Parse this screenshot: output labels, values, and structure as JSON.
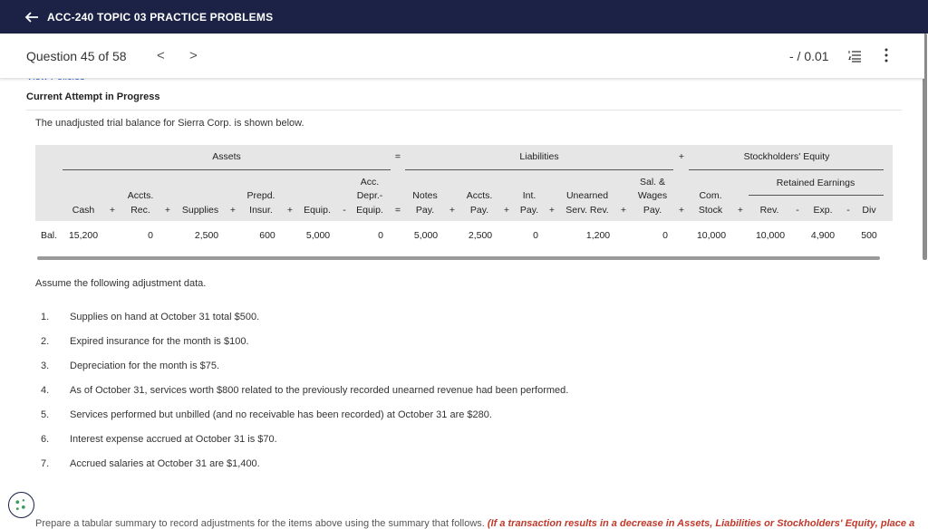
{
  "topbar": {
    "title": "ACC-240 TOPIC 03 PRACTICE PROBLEMS"
  },
  "qbar": {
    "question": "Question 45 of 58",
    "prev": "<",
    "next": ">",
    "score": "- / 0.01"
  },
  "view_policies": "View Policies",
  "attempt": "Current Attempt in Progress",
  "intro": "The unadjusted trial balance for Sierra Corp. is shown below.",
  "table": {
    "group_assets": "Assets",
    "equals": "=",
    "group_liabilities": "Liabilities",
    "plus": "+",
    "group_equity": "Stockholders' Equity",
    "retained_earnings": "Retained Earnings",
    "cols": {
      "cash": "Cash",
      "accts_rec_1": "Accts.",
      "accts_rec_2": "Rec.",
      "supplies": "Supplies",
      "prepd_1": "Prepd.",
      "prepd_2": "Insur.",
      "equip": "Equip.",
      "accdepr_1": "Acc.",
      "accdepr_2": "Depr.-",
      "accdepr_3": "Equip.",
      "notes_1": "Notes",
      "notes_2": "Pay.",
      "accts_pay_1": "Accts.",
      "accts_pay_2": "Pay.",
      "int_1": "Int.",
      "int_2": "Pay.",
      "unearned_1": "Unearned",
      "unearned_2": "Serv. Rev.",
      "sal_1": "Sal. &",
      "sal_2": "Wages",
      "sal_3": "Pay.",
      "com_1": "Com.",
      "com_2": "Stock",
      "rev": "Rev.",
      "exp": "Exp.",
      "div": "Div"
    },
    "ops": {
      "plus": "+",
      "minus": "-",
      "eq": "="
    },
    "bal_label": "Bal.",
    "bal": {
      "cash": "15,200",
      "accts_rec": "0",
      "supplies": "2,500",
      "prepd": "600",
      "equip": "5,000",
      "accdepr": "0",
      "notes": "5,000",
      "accts_pay": "2,500",
      "int": "0",
      "unearned": "1,200",
      "sal": "0",
      "com": "10,000",
      "rev": "10,000",
      "exp": "4,900",
      "div": "500"
    }
  },
  "assume": "Assume the following adjustment data.",
  "adjustments": [
    {
      "n": "1.",
      "text": "Supplies on hand at October 31 total $500."
    },
    {
      "n": "2.",
      "text": "Expired insurance for the month is $100."
    },
    {
      "n": "3.",
      "text": "Depreciation for the month is $75."
    },
    {
      "n": "4.",
      "text": "As of October 31, services worth $800 related to the previously recorded unearned revenue had been performed."
    },
    {
      "n": "5.",
      "text": "Services performed but unbilled (and no receivable has been recorded) at October 31 are $280."
    },
    {
      "n": "6.",
      "text": "Interest expense accrued at October 31 is $70."
    },
    {
      "n": "7.",
      "text": "Accrued salaries at October 31 are $1,400."
    }
  ],
  "bottom": {
    "text": "Prepare a tabular summary to record adjustments for the items above using the summary that follows. ",
    "red": "(If a transaction results in a decrease in Assets, Liabilities or Stockholders' Equity, place a"
  },
  "colors": {
    "topbar": "#1b2245",
    "table_bg": "#e6e6e6",
    "link": "#2a5bd7",
    "warning": "#c0392b"
  }
}
